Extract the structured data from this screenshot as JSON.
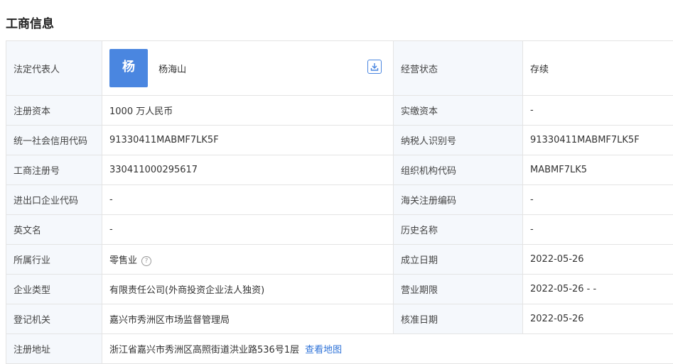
{
  "section_title": "工商信息",
  "rows": [
    {
      "l1": "法定代表人",
      "v1": "杨海山",
      "l2": "经营状态",
      "v2": "存续"
    },
    {
      "l1": "注册资本",
      "v1": "1000 万人民币",
      "l2": "实缴资本",
      "v2": "-"
    },
    {
      "l1": "统一社会信用代码",
      "v1": "91330411MABMF7LK5F",
      "l2": "纳税人识别号",
      "v2": "91330411MABMF7LK5F"
    },
    {
      "l1": "工商注册号",
      "v1": "330411000295617",
      "l2": "组织机构代码",
      "v2": "MABMF7LK5"
    },
    {
      "l1": "进出口企业代码",
      "v1": "-",
      "l2": "海关注册编码",
      "v2": "-"
    },
    {
      "l1": "英文名",
      "v1": "-",
      "l2": "历史名称",
      "v2": "-"
    },
    {
      "l1": "所属行业",
      "v1": "零售业",
      "l2": "成立日期",
      "v2": "2022-05-26"
    },
    {
      "l1": "企业类型",
      "v1": "有限责任公司(外商投资企业法人独资)",
      "l2": "营业期限",
      "v2": "2022-05-26 - -"
    },
    {
      "l1": "登记机关",
      "v1": "嘉兴市秀洲区市场监督管理局",
      "l2": "核准日期",
      "v2": "2022-05-26"
    },
    {
      "l1": "注册地址",
      "v1": "浙江省嘉兴市秀洲区高照街道洪业路536号1层"
    }
  ],
  "avatar_char": "杨",
  "help_glyph": "?",
  "map_link": "查看地图",
  "icons": {
    "download": "download-icon",
    "help": "question-circle-icon"
  },
  "colors": {
    "accent": "#4a86e0",
    "label_bg": "#f5f8fc",
    "border": "#e4e4e4",
    "link": "#2f73d8"
  }
}
